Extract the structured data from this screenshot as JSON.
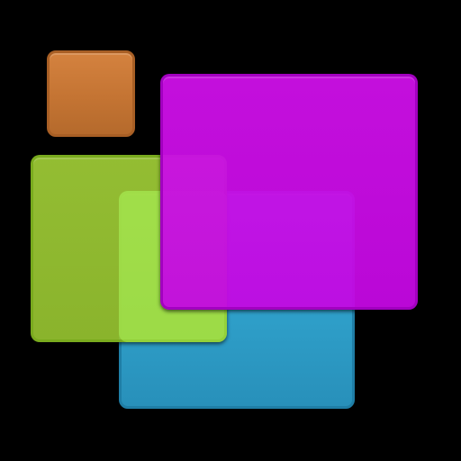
{
  "icon": {
    "background": "#000000",
    "tiles": [
      {
        "name": "orange-square",
        "color": "#c47433"
      },
      {
        "name": "blue-rectangle",
        "color": "#2e9ec8"
      },
      {
        "name": "green-rectangle",
        "color": "#96c330"
      },
      {
        "name": "magenta-rectangle",
        "color": "#c408e2"
      }
    ]
  }
}
